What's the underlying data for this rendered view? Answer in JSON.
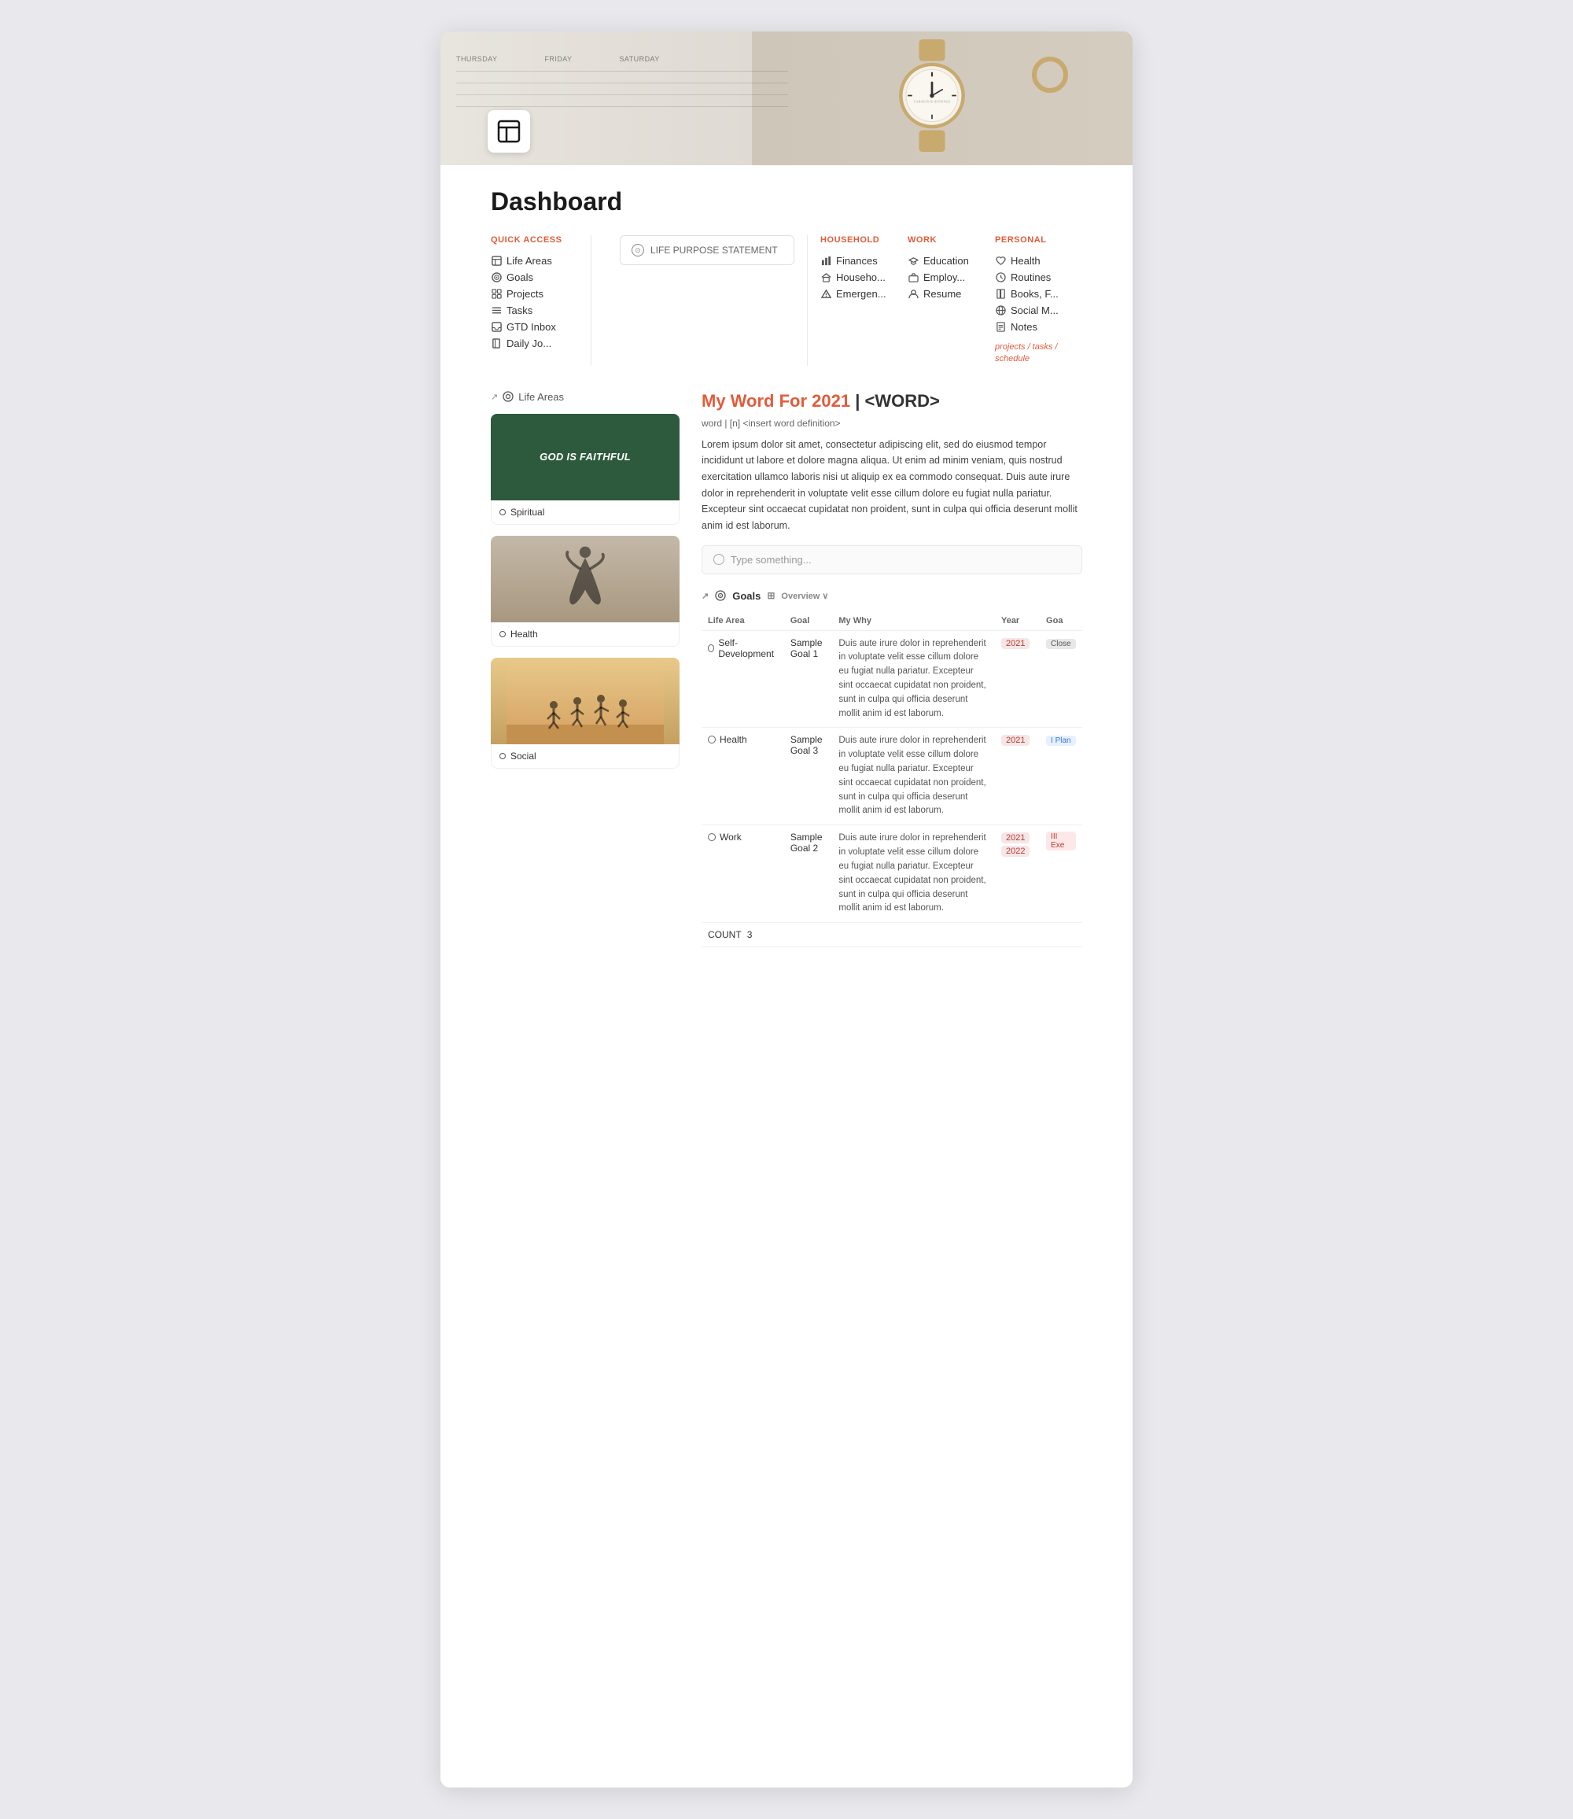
{
  "page": {
    "title": "Dashboard"
  },
  "hero": {
    "calendar_days": [
      "Thursday",
      "Friday",
      "Saturday"
    ]
  },
  "quick_access": {
    "section_title": "QUICK ACCESS",
    "items": [
      {
        "label": "Life Areas",
        "icon": "layers"
      },
      {
        "label": "Goals",
        "icon": "target"
      },
      {
        "label": "Projects",
        "icon": "grid"
      },
      {
        "label": "Tasks",
        "icon": "list"
      },
      {
        "label": "GTD Inbox",
        "icon": "inbox"
      },
      {
        "label": "Daily Jo...",
        "icon": "book"
      }
    ]
  },
  "life_purpose": {
    "label": "LIFE PURPOSE STATEMENT"
  },
  "household": {
    "title": "HOUSEHOLD",
    "items": [
      {
        "label": "Finances",
        "icon": "bar-chart"
      },
      {
        "label": "Househo...",
        "icon": "home"
      },
      {
        "label": "Emergen...",
        "icon": "alert"
      }
    ]
  },
  "work": {
    "title": "WORK",
    "items": [
      {
        "label": "Education",
        "icon": "graduation"
      },
      {
        "label": "Employ...",
        "icon": "briefcase"
      },
      {
        "label": "Resume",
        "icon": "user"
      }
    ]
  },
  "personal": {
    "title": "PERSONAL",
    "items": [
      {
        "label": "Health",
        "icon": "heart"
      },
      {
        "label": "Routines",
        "icon": "clock"
      },
      {
        "label": "Books, F...",
        "icon": "book"
      },
      {
        "label": "Social M...",
        "icon": "globe"
      },
      {
        "label": "Notes",
        "icon": "file"
      }
    ],
    "links": "projects / tasks / schedule"
  },
  "life_areas": {
    "section_label": "Life Areas",
    "cards": [
      {
        "label": "Spiritual",
        "type": "spiritual",
        "text_overlay": "GOD IS\nFAITHFUL"
      },
      {
        "label": "Health",
        "type": "health"
      },
      {
        "label": "Social",
        "type": "social"
      }
    ]
  },
  "word_section": {
    "title_accent": "My Word For 2021",
    "title_template": " | <WORD>",
    "definition_label": "word | [n] <insert word definition>",
    "body_text": "Lorem ipsum dolor sit amet, consectetur adipiscing elit, sed do eiusmod tempor incididunt ut labore et dolore magna aliqua. Ut enim ad minim veniam, quis nostrud exercitation ullamco laboris nisi ut aliquip ex ea commodo consequat. Duis aute irure dolor in reprehenderit in voluptate velit esse cillum dolore eu fugiat nulla pariatur. Excepteur sint occaecat cupidatat non proident, sunt in culpa qui officia deserunt mollit anim id est laborum.",
    "input_placeholder": "Type something..."
  },
  "goals": {
    "section_label": "Goals",
    "view_label": "Overview",
    "columns": [
      "Life Area",
      "Goal",
      "My Why",
      "Year",
      "Goa"
    ],
    "rows": [
      {
        "life_area": "Self-Development",
        "goal": "Sample Goal 1",
        "why": "Duis aute irure dolor in reprehenderit in voluptate velit esse cillum dolore eu fugiat nulla pariatur. Excepteur sint occaecat cupidatat non proident, sunt in culpa qui officia deserunt mollit anim id est laborum.",
        "years": [
          "2021"
        ],
        "status": "Close",
        "status_type": "close"
      },
      {
        "life_area": "Health",
        "goal": "Sample Goal 3",
        "why": "Duis aute irure dolor in reprehenderit in voluptate velit esse cillum dolore eu fugiat nulla pariatur. Excepteur sint occaecat cupidatat non proident, sunt in culpa qui officia deserunt mollit anim id est laborum.",
        "years": [
          "2021"
        ],
        "status": "I Plan",
        "status_type": "plan"
      },
      {
        "life_area": "Work",
        "goal": "Sample Goal 2",
        "why": "Duis aute irure dolor in reprehenderit in voluptate velit esse cillum dolore eu fugiat nulla pariatur. Excepteur sint occaecat cupidatat non proident, sunt in culpa qui officia deserunt mollit anim id est laborum.",
        "years": [
          "2021",
          "2022"
        ],
        "status": "III Exe",
        "status_type": "exe"
      }
    ],
    "count_label": "COUNT",
    "count_value": "3"
  }
}
